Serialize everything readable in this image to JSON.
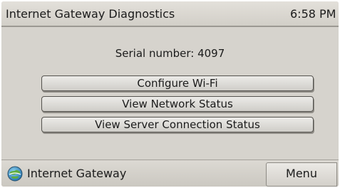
{
  "header": {
    "title": "Internet Gateway Diagnostics",
    "time": "6:58 PM"
  },
  "main": {
    "serial_number": "Serial number: 4097",
    "buttons": [
      {
        "label": "Configure Wi-Fi"
      },
      {
        "label": "View Network Status"
      },
      {
        "label": "View Server Connection Status"
      }
    ]
  },
  "footer": {
    "app_icon": "globe-icon",
    "app_label": "Internet Gateway",
    "menu_label": "Menu"
  },
  "colors": {
    "background": "#d6d3cd",
    "button_face": "#e2e0dc",
    "text": "#1b1b1b"
  }
}
